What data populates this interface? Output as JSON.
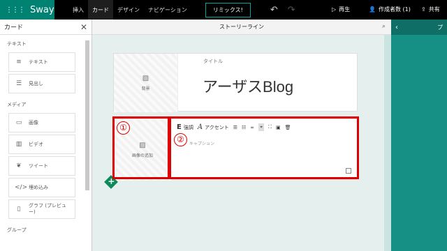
{
  "app": {
    "name": "Sway"
  },
  "nav": {
    "tabs": [
      "挿入",
      "カード",
      "デザイン",
      "ナビゲーション"
    ],
    "remix": "リミックス!",
    "play": "再生",
    "authors": "作成者数 (1)",
    "share": "共有"
  },
  "left_panel": {
    "title": "カード",
    "sections": [
      {
        "title": "テキスト",
        "items": [
          "テキスト",
          "見出し"
        ]
      },
      {
        "title": "メディア",
        "items": [
          "画像",
          "ビデオ",
          "ツイート",
          "埋め込み",
          "グラフ (プレビュー)"
        ]
      },
      {
        "title": "グループ",
        "items": []
      }
    ]
  },
  "storyline": {
    "header": "ストーリーライン",
    "title_card": {
      "bg_label": "背景",
      "label": "タイトル",
      "title": "アーザスBlog"
    },
    "text_card": {
      "add_image_label": "画像の追加",
      "toolbar": {
        "emphasis": "強調",
        "accent": "アクセント"
      },
      "caption_placeholder": "キャプション"
    }
  },
  "annotations": {
    "n1": "①",
    "n2": "②"
  },
  "right_pane": {
    "label": "プ"
  }
}
